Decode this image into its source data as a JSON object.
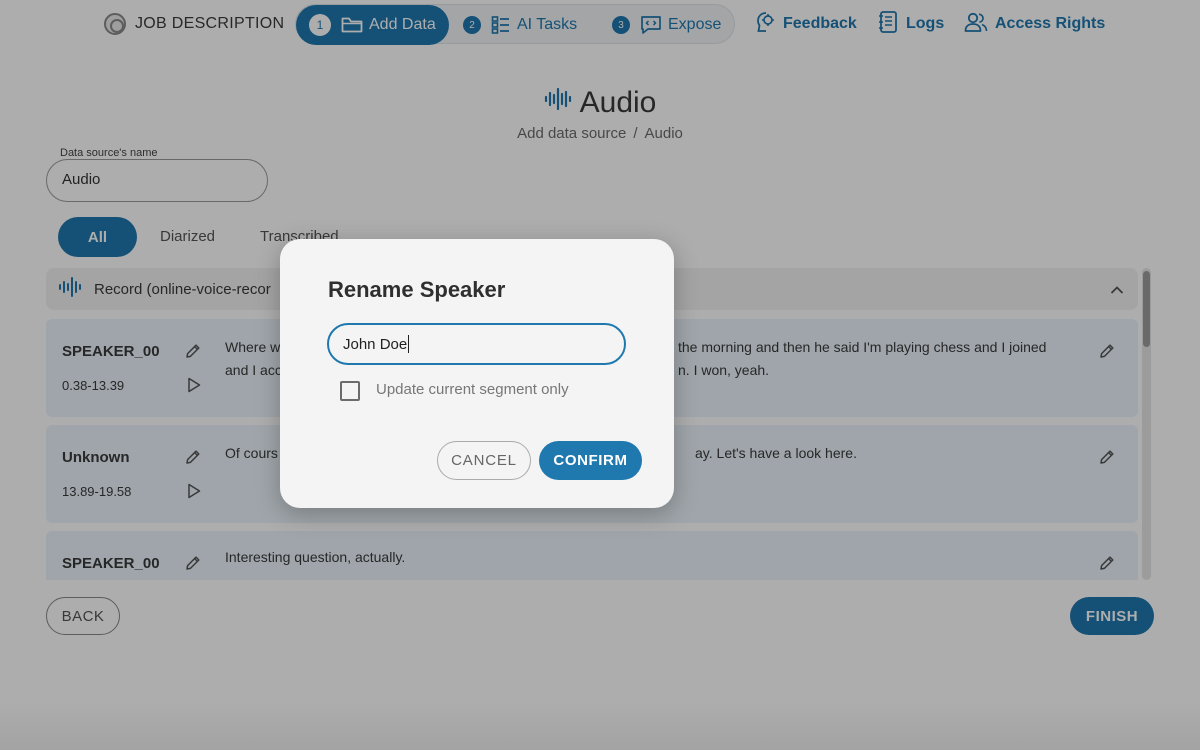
{
  "nav": {
    "job_title": "JOB DESCRIPTION",
    "steps": [
      {
        "num": "1",
        "label": "Add Data",
        "icon": "folder-icon",
        "active": true
      },
      {
        "num": "2",
        "label": "AI Tasks",
        "icon": "list-icon",
        "active": false
      },
      {
        "num": "3",
        "label": "Expose",
        "icon": "code-chat-icon",
        "active": false
      }
    ],
    "links": [
      {
        "label": "Feedback",
        "icon": "feedback-icon"
      },
      {
        "label": "Logs",
        "icon": "logs-icon"
      },
      {
        "label": "Access Rights",
        "icon": "users-icon"
      }
    ]
  },
  "page": {
    "title": "Audio",
    "title_icon": "audio-wave-icon",
    "breadcrumb": [
      "Add data source",
      "Audio"
    ],
    "breadcrumb_sep": "/"
  },
  "source_field": {
    "label": "Data source's name",
    "value": "Audio"
  },
  "filters": {
    "tabs": [
      "All",
      "Diarized",
      "Transcribed"
    ],
    "selected": "All"
  },
  "record": {
    "title": "Record (online-voice-recor",
    "icon": "audio-wave-icon"
  },
  "segments": [
    {
      "speaker": "SPEAKER_00",
      "time": "0.38-13.39",
      "text_left": "Where w",
      "text_left_2": "and I acc",
      "text_right": "the morning and then he said I'm playing chess and I joined",
      "text_right_2": "n. I won, yeah."
    },
    {
      "speaker": "Unknown",
      "time": "13.89-19.58",
      "text_left": "Of cours",
      "text_right": "ay. Let's have a look here."
    },
    {
      "speaker": "SPEAKER_00",
      "time": "",
      "text_left": "Interesting question, actually."
    }
  ],
  "footer": {
    "back_label": "BACK",
    "finish_label": "FINISH"
  },
  "dialog": {
    "title": "Rename Speaker",
    "input_value": "John Doe",
    "checkbox_label": "Update current segment only",
    "checkbox_checked": false,
    "cancel_label": "CANCEL",
    "confirm_label": "CONFIRM"
  },
  "colors": {
    "primary": "#1f78ae",
    "segment_bg": "#eaf4fb",
    "dialog_bg": "#f4f4f4"
  }
}
